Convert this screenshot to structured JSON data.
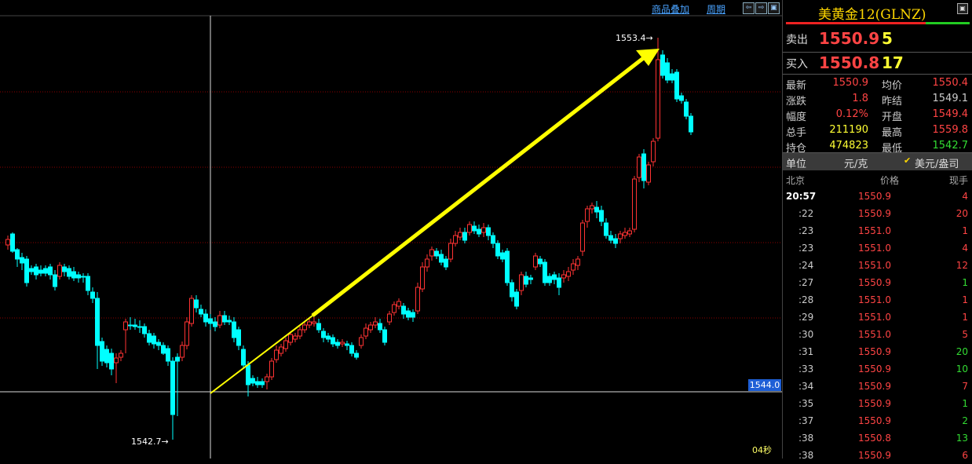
{
  "toolbar": {
    "overlay_label": "商品叠加",
    "period_label": "周期"
  },
  "chart": {
    "high_label": "1553.4→",
    "low_label": "1542.7→",
    "price_axis_label": "1544.0",
    "timer_label": "04秒",
    "colors": {
      "up": "#ff3333",
      "down": "#00ffff",
      "grid": "#8b0000",
      "arrow": "#ffff00",
      "background": "#000000"
    }
  },
  "panel": {
    "title": "美黄金12(GLNZ)",
    "sell": {
      "label": "卖出",
      "price": "1550.9",
      "volume": "5"
    },
    "buy": {
      "label": "买入",
      "price": "1550.8",
      "volume": "17"
    },
    "stats": [
      {
        "l1": "最新",
        "v1": "1550.9",
        "l2": "均价",
        "v2": "1550.4"
      },
      {
        "l1": "涨跌",
        "v1": "1.8",
        "l2": "昨结",
        "v2": "1549.1"
      },
      {
        "l1": "幅度",
        "v1": "0.12%",
        "l2": "开盘",
        "v2": "1549.4"
      },
      {
        "l1": "总手",
        "v1": "211190",
        "l2": "最高",
        "v2": "1559.8"
      },
      {
        "l1": "持仓",
        "v1": "474823",
        "l2": "最低",
        "v2": "1542.7"
      }
    ],
    "unit": {
      "label": "单位",
      "value": "元/克",
      "option": "美元/盎司"
    },
    "ticks_header": {
      "time": "北京",
      "price": "价格",
      "volume": "现手"
    },
    "ticks": [
      {
        "time": "20:57",
        "price": "1550.9",
        "vol": "4",
        "dir": "red"
      },
      {
        "time": ":22",
        "price": "1550.9",
        "vol": "20",
        "dir": "red"
      },
      {
        "time": ":23",
        "price": "1551.0",
        "vol": "1",
        "dir": "red"
      },
      {
        "time": ":23",
        "price": "1551.0",
        "vol": "4",
        "dir": "red"
      },
      {
        "time": ":24",
        "price": "1551.0",
        "vol": "12",
        "dir": "red"
      },
      {
        "time": ":27",
        "price": "1550.9",
        "vol": "1",
        "dir": "green"
      },
      {
        "time": ":28",
        "price": "1551.0",
        "vol": "1",
        "dir": "red"
      },
      {
        "time": ":29",
        "price": "1551.0",
        "vol": "1",
        "dir": "red"
      },
      {
        "time": ":30",
        "price": "1551.0",
        "vol": "5",
        "dir": "red"
      },
      {
        "time": ":31",
        "price": "1550.9",
        "vol": "20",
        "dir": "green"
      },
      {
        "time": ":33",
        "price": "1550.9",
        "vol": "10",
        "dir": "green"
      },
      {
        "time": ":34",
        "price": "1550.9",
        "vol": "7",
        "dir": "red"
      },
      {
        "time": ":35",
        "price": "1550.9",
        "vol": "1",
        "dir": "green"
      },
      {
        "time": ":37",
        "price": "1550.9",
        "vol": "2",
        "dir": "green"
      },
      {
        "time": ":38",
        "price": "1550.8",
        "vol": "13",
        "dir": "green"
      },
      {
        "time": ":38",
        "price": "1550.9",
        "vol": "6",
        "dir": "red"
      }
    ]
  }
}
